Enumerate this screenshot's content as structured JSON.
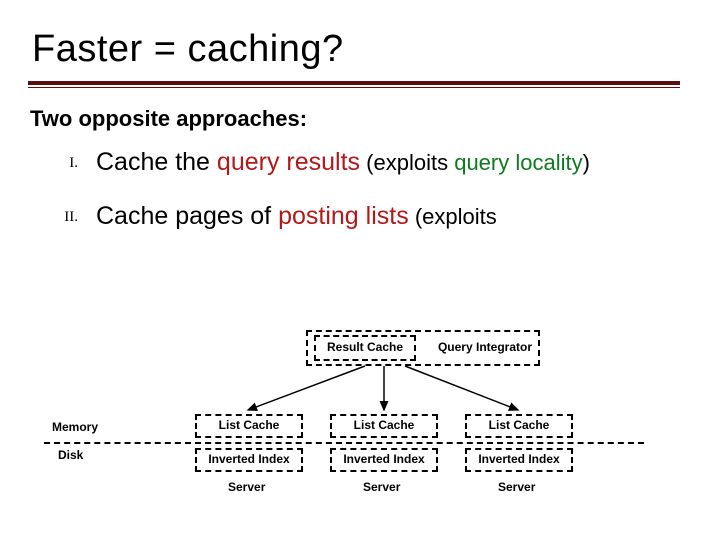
{
  "title": "Faster = caching?",
  "intro": "Two opposite approaches:",
  "items": [
    {
      "num": "I.",
      "plain1": "Cache the ",
      "hl": "query results",
      "paren_open": "   (exploits ",
      "green": "query locality",
      "paren_close": ")"
    },
    {
      "num": "II.",
      "plain1": "Cache pages of ",
      "hl": "posting lists",
      "paren_open": " (exploits ",
      "green": "",
      "paren_close": ""
    }
  ],
  "diagram": {
    "result_cache": "Result Cache",
    "query_integrator": "Query Integrator",
    "list_cache": "List Cache",
    "inverted_index": "Inverted Index",
    "memory": "Memory",
    "disk": "Disk",
    "server": "Server"
  },
  "chart_data": {
    "type": "diagram",
    "description": "Search-engine caching architecture. A Query Integrator at the top contains a Result Cache and fans out to three identical Server columns. Each Server column has a List Cache (in Memory, above the dashed line) and an Inverted Index (on Disk, below the dashed line).",
    "top": {
      "node": "Query Integrator",
      "contains": "Result Cache"
    },
    "servers": [
      {
        "memory": "List Cache",
        "disk": "Inverted Index",
        "label": "Server"
      },
      {
        "memory": "List Cache",
        "disk": "Inverted Index",
        "label": "Server"
      },
      {
        "memory": "List Cache",
        "disk": "Inverted Index",
        "label": "Server"
      }
    ],
    "row_labels": {
      "above_split": "Memory",
      "below_split": "Disk"
    },
    "edges": [
      {
        "from": "Query Integrator",
        "to": "Server 1"
      },
      {
        "from": "Query Integrator",
        "to": "Server 2"
      },
      {
        "from": "Query Integrator",
        "to": "Server 3"
      }
    ]
  }
}
